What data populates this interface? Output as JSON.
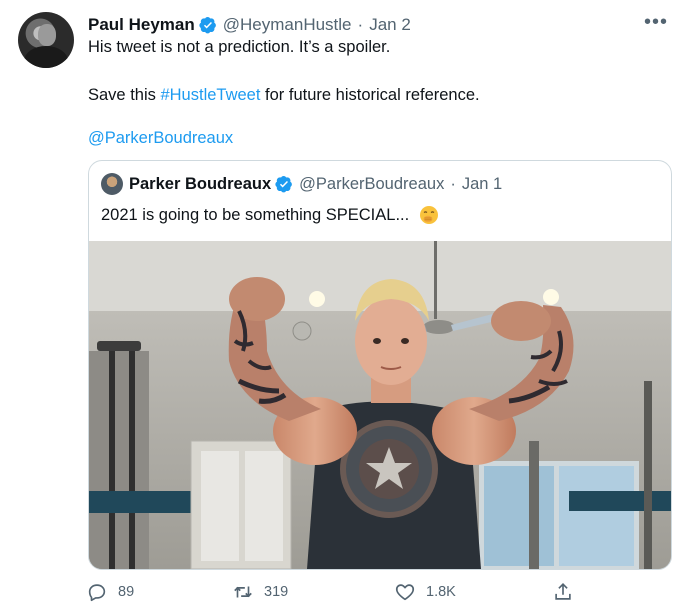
{
  "tweet": {
    "author_name": "Paul Heyman",
    "handle": "@HeymanHustle",
    "separator": "·",
    "date": "Jan 2",
    "more_label": "•••",
    "line1": "His tweet is not a prediction. It’s a spoiler.",
    "line2_prefix": "Save this ",
    "hashtag": "#HustleTweet",
    "line2_suffix": " for future historical reference.",
    "mention": "@ParkerBoudreaux"
  },
  "quoted": {
    "author_name": "Parker Boudreaux",
    "handle": "@ParkerBoudreaux",
    "separator": "·",
    "date": "Jan 1",
    "text": "2021 is going to be something SPECIAL...",
    "emoji_icon": "face-with-hand-over-mouth-emoji"
  },
  "actions": {
    "reply_count": "89",
    "retweet_count": "319",
    "like_count": "1.8K"
  },
  "colors": {
    "link": "#1d9bf0",
    "verified": "#1d9bf0",
    "secondary_text": "#536471",
    "border": "#cfd9de"
  }
}
